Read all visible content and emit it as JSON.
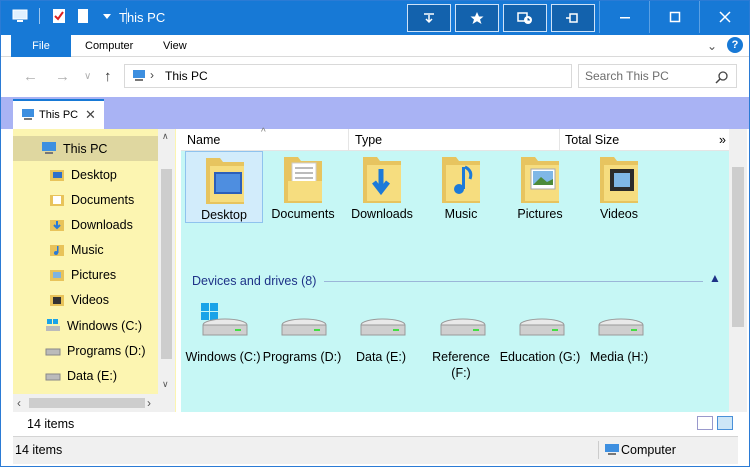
{
  "window": {
    "title": "This PC"
  },
  "ribbon": {
    "tabs": [
      "File",
      "Computer",
      "View"
    ]
  },
  "address": {
    "path": "This PC"
  },
  "search": {
    "placeholder": "Search This PC"
  },
  "tab": {
    "label": "This PC"
  },
  "nav": {
    "items": [
      {
        "label": "This PC",
        "icon": "computer-icon"
      },
      {
        "label": "Desktop",
        "icon": "desktop-folder-icon"
      },
      {
        "label": "Documents",
        "icon": "documents-folder-icon"
      },
      {
        "label": "Downloads",
        "icon": "downloads-folder-icon"
      },
      {
        "label": "Music",
        "icon": "music-folder-icon"
      },
      {
        "label": "Pictures",
        "icon": "pictures-folder-icon"
      },
      {
        "label": "Videos",
        "icon": "videos-folder-icon"
      },
      {
        "label": "Windows (C:)",
        "icon": "windows-drive-icon"
      },
      {
        "label": "Programs (D:)",
        "icon": "drive-icon"
      },
      {
        "label": "Data (E:)",
        "icon": "drive-icon"
      }
    ]
  },
  "columns": {
    "name": "Name",
    "type": "Type",
    "total_size": "Total Size",
    "more": "»"
  },
  "folders": [
    {
      "label": "Desktop"
    },
    {
      "label": "Documents"
    },
    {
      "label": "Downloads"
    },
    {
      "label": "Music"
    },
    {
      "label": "Pictures"
    },
    {
      "label": "Videos"
    }
  ],
  "drives_group": {
    "title": "Devices and drives (8)"
  },
  "drives": [
    {
      "label": "Windows (C:)"
    },
    {
      "label": "Programs (D:)"
    },
    {
      "label": "Data (E:)"
    },
    {
      "label": "Reference (F:)"
    },
    {
      "label": "Education (G:)"
    },
    {
      "label": "Media (H:)"
    }
  ],
  "status": {
    "items": "14 items",
    "bottom_items": "14 items",
    "computer": "Computer"
  },
  "colors": {
    "accent": "#1779d6",
    "tabstrip": "#a9b3f4",
    "navpane": "#fcf5b1",
    "content": "#c6f7f5"
  }
}
